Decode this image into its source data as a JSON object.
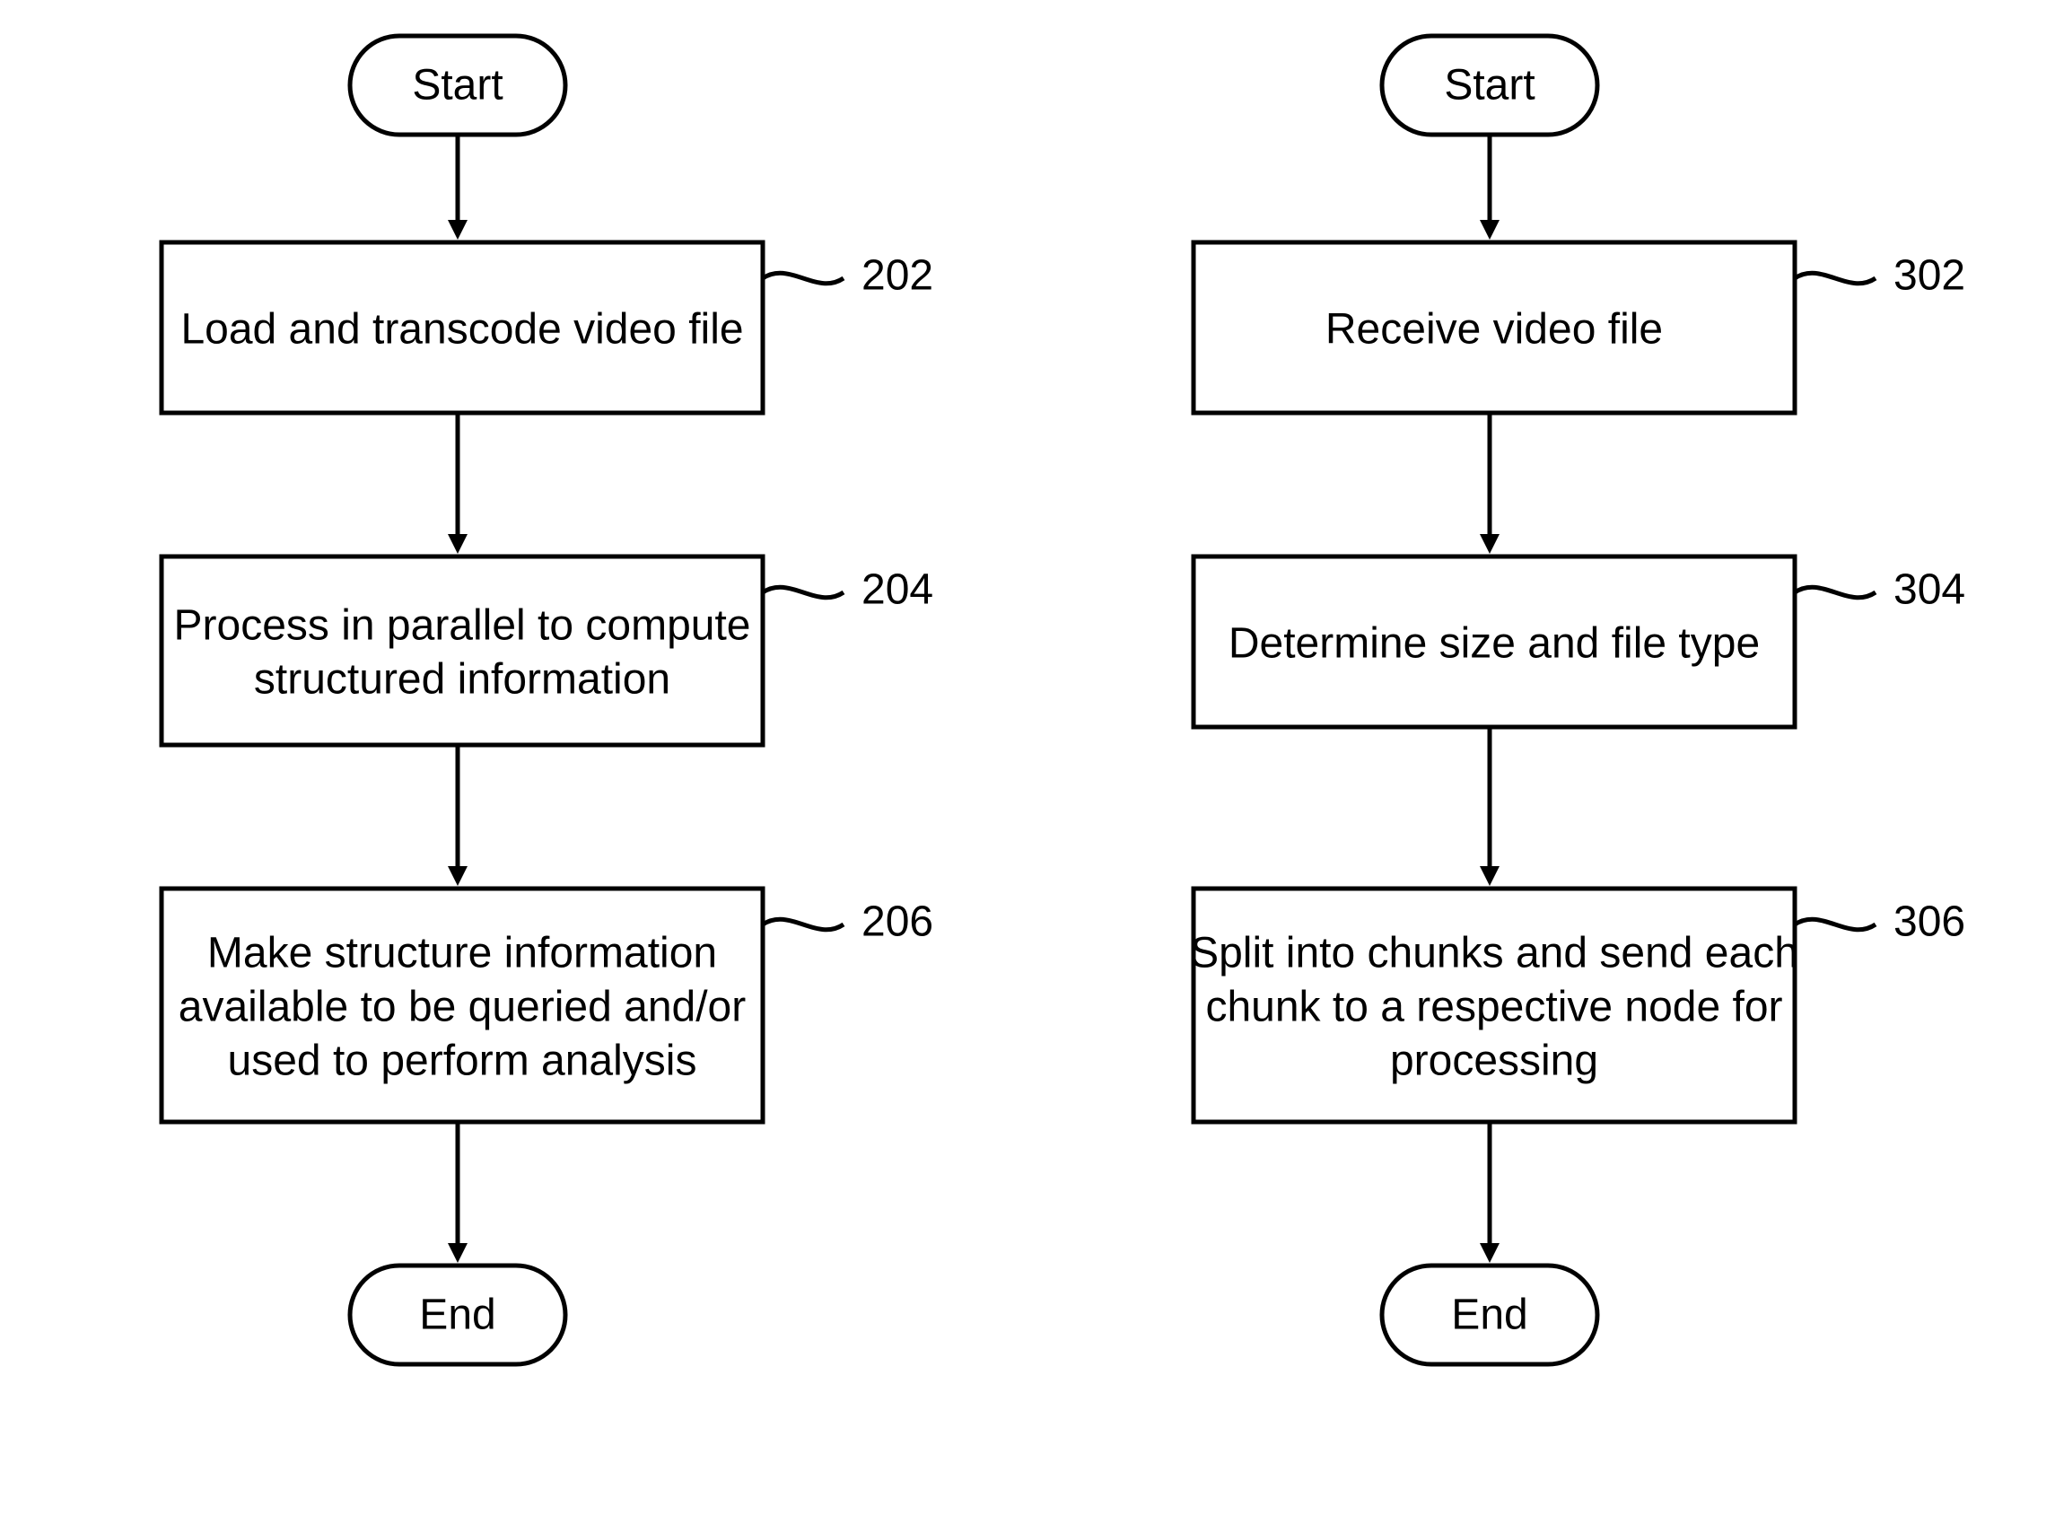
{
  "left": {
    "start": "Start",
    "step1": {
      "label": "202",
      "text": "Load and transcode video file"
    },
    "step2": {
      "label": "204",
      "line1": "Process in parallel to compute",
      "line2": "structured information"
    },
    "step3": {
      "label": "206",
      "line1": "Make structure information",
      "line2": "available to be queried and/or",
      "line3": "used to perform analysis"
    },
    "end": "End"
  },
  "right": {
    "start": "Start",
    "step1": {
      "label": "302",
      "text": "Receive video file"
    },
    "step2": {
      "label": "304",
      "text": "Determine size and file type"
    },
    "step3": {
      "label": "306",
      "line1": "Split into chunks and send each",
      "line2": "chunk to a respective node for",
      "line3": "processing"
    },
    "end": "End"
  }
}
